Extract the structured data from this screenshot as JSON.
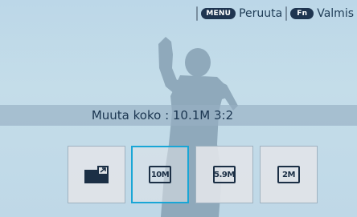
{
  "topbar": {
    "menu_key": "MENU",
    "menu_action": "Peruuta",
    "fn_key": "Fn",
    "fn_action": "Valmis"
  },
  "caption": "Muuta koko : 10.1M 3:2",
  "options": [
    {
      "icon": "resize-icon",
      "label": ""
    },
    {
      "icon": "size-10.1m-icon",
      "label": "10M"
    },
    {
      "icon": "size-5.9m-icon",
      "label": "5.9M"
    },
    {
      "icon": "size-2m-icon",
      "label": "2M"
    }
  ],
  "selected_index": 1,
  "colors": {
    "accent": "#19a6d6",
    "background": "#c4dde9",
    "text": "#1e3b55"
  }
}
